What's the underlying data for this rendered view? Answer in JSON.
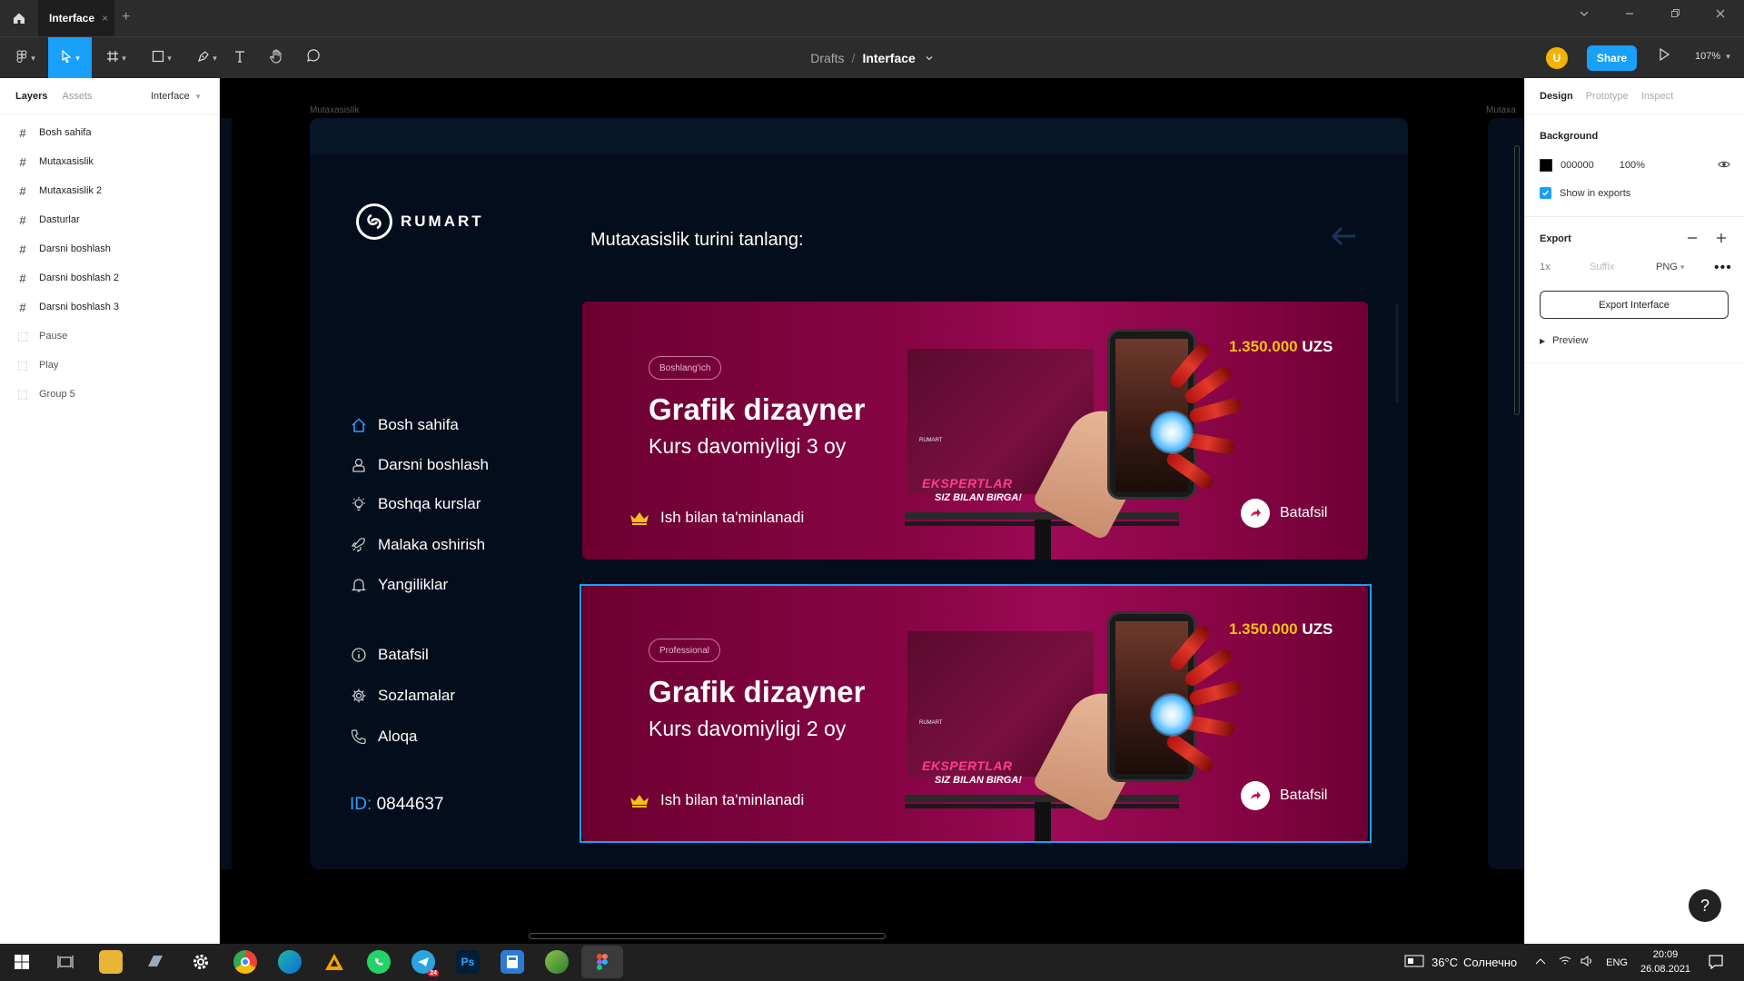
{
  "window": {
    "tab_title": "Interface",
    "tab_close": "×",
    "new_tab": "+"
  },
  "toolbar": {
    "breadcrumb_parent": "Drafts",
    "breadcrumb_sep": "/",
    "file_name": "Interface",
    "avatar_initial": "U",
    "share_label": "Share",
    "zoom": "107%"
  },
  "layers_panel": {
    "tab_layers": "Layers",
    "tab_assets": "Assets",
    "page_name": "Interface",
    "items": [
      {
        "label": "Bosh sahifa",
        "type": "frame"
      },
      {
        "label": "Mutaxasislik",
        "type": "frame"
      },
      {
        "label": "Mutaxasislik 2",
        "type": "frame"
      },
      {
        "label": "Dasturlar",
        "type": "frame"
      },
      {
        "label": "Darsni boshlash",
        "type": "frame"
      },
      {
        "label": "Darsni boshlash 2",
        "type": "frame"
      },
      {
        "label": "Darsni boshlash 3",
        "type": "frame"
      },
      {
        "label": "Pause",
        "type": "group"
      },
      {
        "label": "Play",
        "type": "group"
      },
      {
        "label": "Group 5",
        "type": "group"
      }
    ]
  },
  "design_panel": {
    "tab_design": "Design",
    "tab_prototype": "Prototype",
    "tab_inspect": "Inspect",
    "background_title": "Background",
    "bg_hex": "000000",
    "bg_opacity": "100%",
    "show_in_exports": "Show in exports",
    "export_title": "Export",
    "export_scale": "1x",
    "export_suffix_placeholder": "Suffix",
    "export_format": "PNG",
    "export_button": "Export Interface",
    "preview": "Preview",
    "help": "?"
  },
  "canvas": {
    "frame_label": "Mutaxasislik",
    "frame_label_next": "Mutaxa",
    "logo_text": "RUMART",
    "heading": "Mutaxasislik turini tanlang:",
    "nav": [
      {
        "label": "Bosh sahifa",
        "icon": "home-icon"
      },
      {
        "label": "Darsni boshlash",
        "icon": "user-icon"
      },
      {
        "label": "Boshqa kurslar",
        "icon": "lightbulb-icon"
      },
      {
        "label": "Malaka oshirish",
        "icon": "rocket-icon"
      },
      {
        "label": "Yangiliklar",
        "icon": "bell-icon"
      },
      {
        "label": "Batafsil",
        "icon": "info-icon"
      },
      {
        "label": "Sozlamalar",
        "icon": "gear-icon"
      },
      {
        "label": "Aloqa",
        "icon": "phone-icon"
      }
    ],
    "id_label": "ID:",
    "id_value": "0844637",
    "cards": [
      {
        "badge": "Boshlang'ich",
        "title": "Grafik dizayner",
        "subtitle": "Kurs davomiyligi 3 oy",
        "price": "1.350.000",
        "currency": "UZS",
        "warranty": "Ish bilan ta'minlanadi",
        "more": "Batafsil",
        "billboard_line1": "EKSPERTLAR",
        "billboard_line2": "SIZ BILAN BIRGA!",
        "billboard_brand": "RUMART"
      },
      {
        "badge": "Professional",
        "title": "Grafik dizayner",
        "subtitle": "Kurs davomiyligi 2 oy",
        "price": "1.350.000",
        "currency": "UZS",
        "warranty": "Ish bilan ta'minlanadi",
        "more": "Batafsil",
        "billboard_line1": "EKSPERTLAR",
        "billboard_line2": "SIZ BILAN BIRGA!",
        "billboard_brand": "RUMART"
      }
    ]
  },
  "taskbar": {
    "ps_label": "Ps",
    "telegram_badge": "24",
    "weather": "36°C",
    "weather_text": "Солнечно",
    "lang": "ENG",
    "time": "20:09",
    "date": "26.08.2021"
  },
  "colors": {
    "accent": "#18a0fb",
    "card_bg": "#8a0547",
    "price": "#f7bd1b",
    "frame_bg": "#040d1b"
  }
}
